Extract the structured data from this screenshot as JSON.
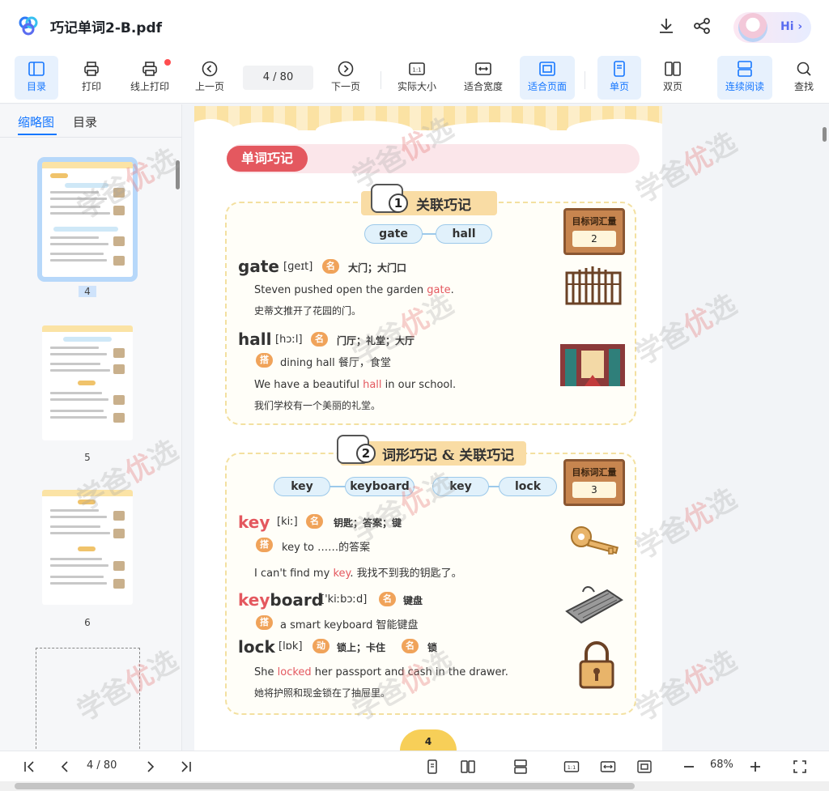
{
  "titlebar": {
    "title": "巧记单词2-B.pdf",
    "download_icon": "download-icon",
    "share_icon": "share-icon",
    "hi_label": "Hi ›"
  },
  "toolbar": {
    "toc": "目录",
    "print": "打印",
    "online_print": "线上打印",
    "prev_page": "上一页",
    "page_indicator": "4  / 80",
    "next_page": "下一页",
    "actual_size": "实际大小",
    "fit_width": "适合宽度",
    "fit_page": "适合页面",
    "single_page": "单页",
    "double_page": "双页",
    "continuous": "连续阅读",
    "find": "查找"
  },
  "sidebar": {
    "tab_thumbnails": "缩略图",
    "tab_toc": "目录",
    "thumbnails": [
      {
        "page": "4",
        "selected": true
      },
      {
        "page": "5",
        "selected": false
      },
      {
        "page": "6",
        "selected": false
      }
    ]
  },
  "document": {
    "section_title": "单词巧记",
    "card1": {
      "banner_num": "1",
      "banner_text": "关联巧记",
      "sign_title": "目标词汇量",
      "sign_count": "2",
      "chips": [
        "gate",
        "hall"
      ],
      "words": [
        {
          "word": "gate",
          "phonetic": "[ɡeɪt]",
          "pos": "名",
          "definition": "大门；大门口",
          "example_en_pre": "Steven pushed open the garden ",
          "example_en_hl": "gate",
          "example_en_post": ".",
          "example_zh": "史蒂文推开了花园的门。"
        },
        {
          "word": "hall",
          "phonetic": "[hɔːl]",
          "pos": "名",
          "definition": "门厅；礼堂；大厅",
          "colloc_badge": "搭",
          "collocation": "dining hall 餐厅，食堂",
          "example_en_pre": "We have a beautiful ",
          "example_en_hl": "hall",
          "example_en_post": " in our school.",
          "example_zh": "我们学校有一个美丽的礼堂。"
        }
      ]
    },
    "card2": {
      "banner_num": "2",
      "banner_text": "词形巧记 & 关联巧记",
      "sign_title": "目标词汇量",
      "sign_count": "3",
      "chips": [
        "key",
        "keyboard",
        "key",
        "lock"
      ],
      "words": [
        {
          "word": "key",
          "phonetic": "[kiː]",
          "pos": "名",
          "definition": "钥匙；答案；键",
          "colloc_badge": "搭",
          "collocation": "key to ……的答案",
          "example_en_pre": "I can't find my ",
          "example_en_hl": "key",
          "example_en_post": ". 我找不到我的钥匙了。"
        },
        {
          "word_hl": "key",
          "word_rest": "board",
          "phonetic": "['kiːbɔːd]",
          "pos": "名",
          "definition": "键盘",
          "colloc_badge": "搭",
          "collocation": "a smart keyboard 智能键盘"
        },
        {
          "word": "lock",
          "phonetic": "[lɒk]",
          "pos": "动",
          "definition": "锁上；卡住",
          "pos2": "名",
          "definition2": "锁",
          "example_en_pre": "She ",
          "example_en_hl": "locked",
          "example_en_post": " her passport and cash in the drawer.",
          "example_zh": "她将护照和现金锁在了抽屉里。"
        }
      ]
    },
    "page_number": "4",
    "watermark_a": "学爸",
    "watermark_b": "优",
    "watermark_c": "选"
  },
  "bottombar": {
    "page_indicator": "4  / 80",
    "zoom": "68%"
  }
}
